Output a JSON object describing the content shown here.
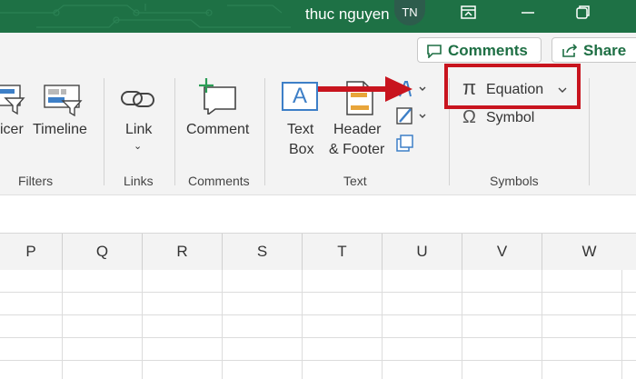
{
  "titlebar": {
    "user_name": "thuc nguyen",
    "avatar_initials": "TN"
  },
  "ribbon": {
    "comments_label": "Comments",
    "share_label": "Share",
    "groups": {
      "filters": {
        "label": "Filters",
        "slicer_label": "icer",
        "timeline_label": "Timeline"
      },
      "links": {
        "label": "Links",
        "link_label": "Link",
        "link_dropdown": "⌄"
      },
      "comments": {
        "label": "Comments",
        "comment_label": "Comment"
      },
      "text": {
        "label": "Text",
        "textbox_label_line1": "Text",
        "textbox_label_line2": "Box",
        "textbox_glyph": "A",
        "header_footer_line1": "Header",
        "header_footer_line2": "& Footer"
      },
      "symbols": {
        "label": "Symbols",
        "equation_label": "Equation",
        "equation_glyph": "π",
        "symbol_label": "Symbol",
        "symbol_glyph": "Ω"
      }
    }
  },
  "grid": {
    "columns": [
      "P",
      "Q",
      "R",
      "S",
      "T",
      "U",
      "V",
      "W"
    ]
  },
  "colors": {
    "titlebar": "#1e7145",
    "brand_green": "#1e6f44",
    "annotation_red": "#c8141e"
  }
}
